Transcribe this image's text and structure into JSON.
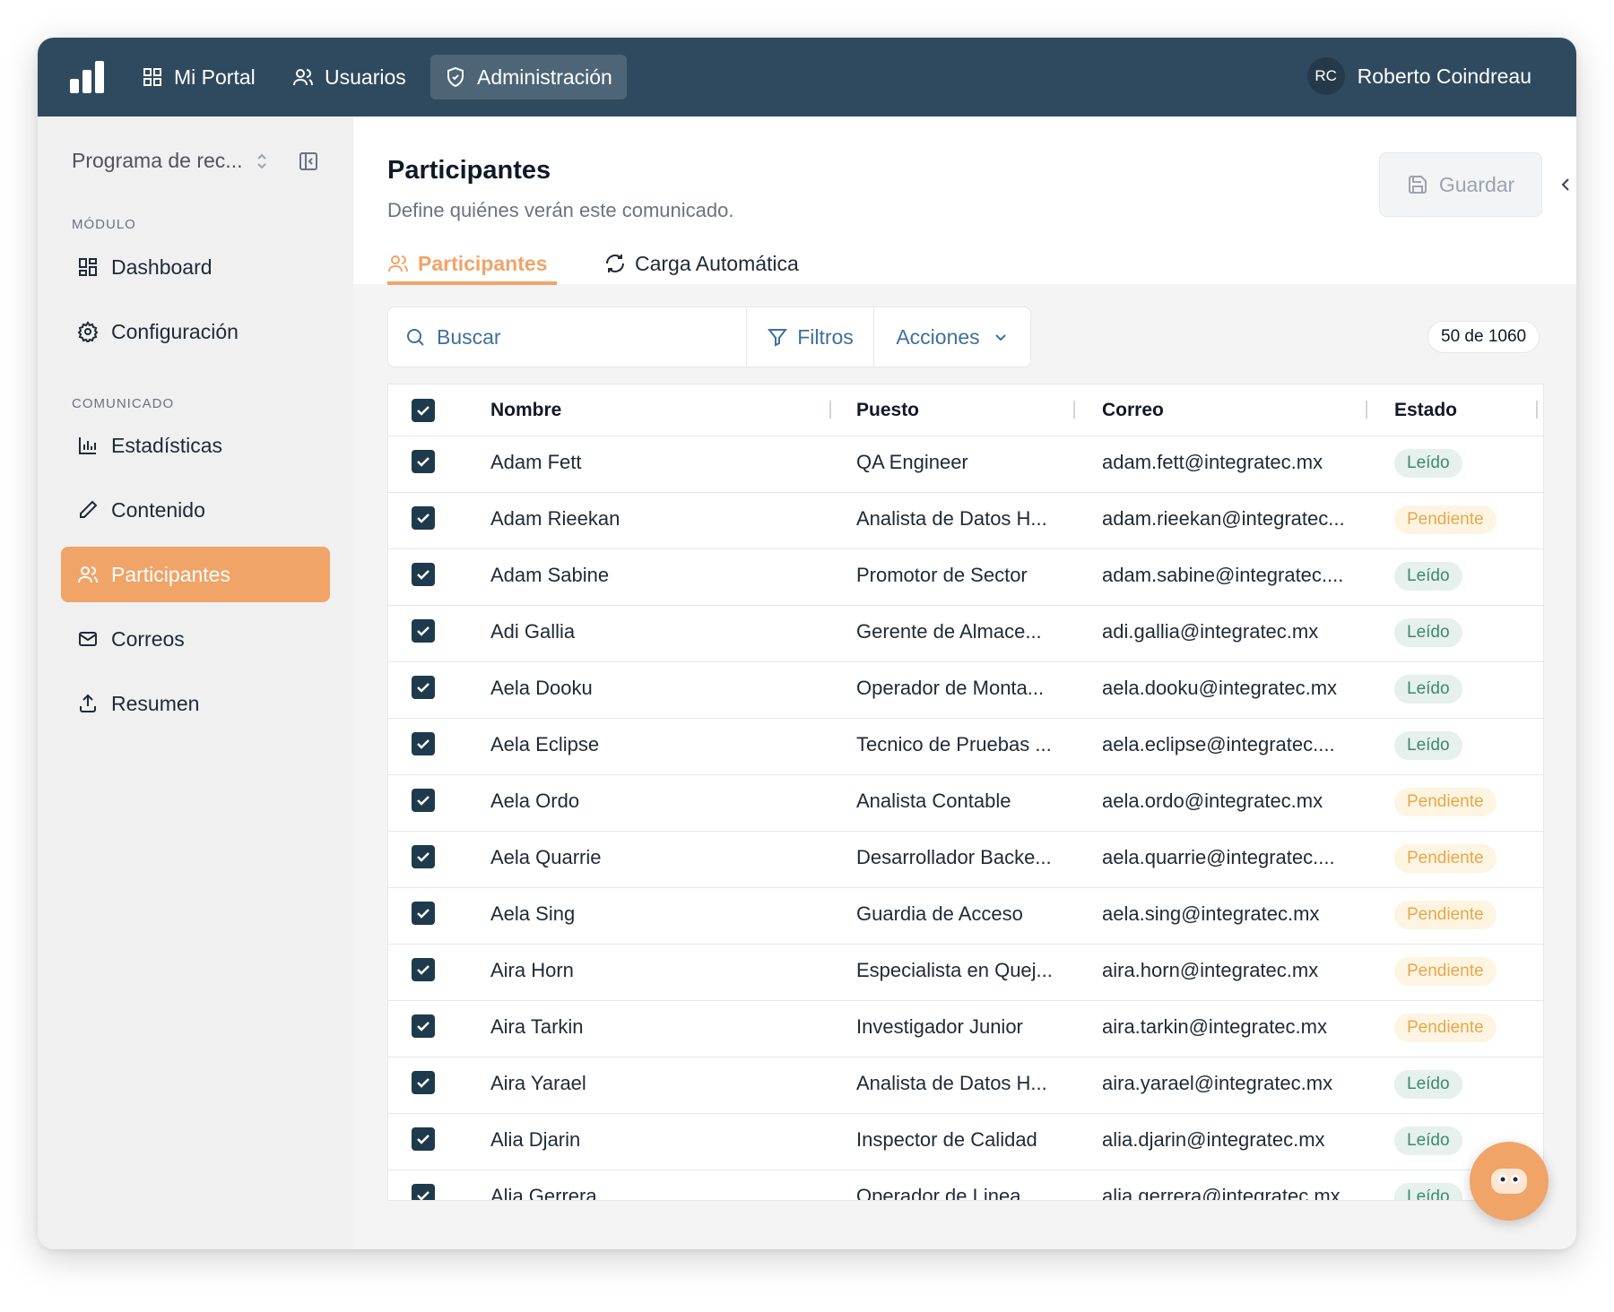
{
  "nav": {
    "items": [
      {
        "label": "Mi Portal",
        "icon": "grid-icon"
      },
      {
        "label": "Usuarios",
        "icon": "users-icon"
      },
      {
        "label": "Administración",
        "icon": "shield-icon"
      }
    ],
    "user": {
      "initials": "RC",
      "name": "Roberto Coindreau"
    }
  },
  "sidebar": {
    "program": "Programa de rec...",
    "section_module": "MÓDULO",
    "section_comunicado": "COMUNICADO",
    "items": [
      {
        "label": "Dashboard",
        "icon": "dashboard-icon"
      },
      {
        "label": "Configuración",
        "icon": "gear-icon"
      },
      {
        "label": "Estadísticas",
        "icon": "bar-chart-icon"
      },
      {
        "label": "Contenido",
        "icon": "pencil-icon"
      },
      {
        "label": "Participantes",
        "icon": "users-icon"
      },
      {
        "label": "Correos",
        "icon": "mail-icon"
      },
      {
        "label": "Resumen",
        "icon": "upload-icon"
      }
    ]
  },
  "main": {
    "title": "Participantes",
    "subtitle": "Define quiénes verán este comunicado.",
    "save_label": "Guardar",
    "tabs": [
      {
        "label": "Participantes",
        "icon": "users-icon"
      },
      {
        "label": "Carga Automática",
        "icon": "refresh-icon"
      }
    ],
    "search_placeholder": "Buscar",
    "filters_label": "Filtros",
    "actions_label": "Acciones",
    "count": "50 de 1060"
  },
  "table": {
    "headers": [
      "Nombre",
      "Puesto",
      "Correo",
      "Estado"
    ],
    "rows": [
      {
        "name": "Adam Fett",
        "role": "QA Engineer",
        "email": "adam.fett@integratec.mx",
        "status": "Leído"
      },
      {
        "name": "Adam Rieekan",
        "role": "Analista de Datos H...",
        "email": "adam.rieekan@integratec...",
        "status": "Pendiente"
      },
      {
        "name": "Adam Sabine",
        "role": "Promotor de Sector",
        "email": "adam.sabine@integratec....",
        "status": "Leído"
      },
      {
        "name": "Adi Gallia",
        "role": "Gerente de Almace...",
        "email": "adi.gallia@integratec.mx",
        "status": "Leído"
      },
      {
        "name": "Aela Dooku",
        "role": "Operador de Monta...",
        "email": "aela.dooku@integratec.mx",
        "status": "Leído"
      },
      {
        "name": "Aela Eclipse",
        "role": "Tecnico de Pruebas ...",
        "email": "aela.eclipse@integratec....",
        "status": "Leído"
      },
      {
        "name": "Aela Ordo",
        "role": "Analista Contable",
        "email": "aela.ordo@integratec.mx",
        "status": "Pendiente"
      },
      {
        "name": "Aela Quarrie",
        "role": "Desarrollador Backe...",
        "email": "aela.quarrie@integratec....",
        "status": "Pendiente"
      },
      {
        "name": "Aela Sing",
        "role": "Guardia de Acceso",
        "email": "aela.sing@integratec.mx",
        "status": "Pendiente"
      },
      {
        "name": "Aira Horn",
        "role": "Especialista en Quej...",
        "email": "aira.horn@integratec.mx",
        "status": "Pendiente"
      },
      {
        "name": "Aira Tarkin",
        "role": "Investigador Junior",
        "email": "aira.tarkin@integratec.mx",
        "status": "Pendiente"
      },
      {
        "name": "Aira Yarael",
        "role": "Analista de Datos H...",
        "email": "aira.yarael@integratec.mx",
        "status": "Leído"
      },
      {
        "name": "Alia Djarin",
        "role": "Inspector de Calidad",
        "email": "alia.djarin@integratec.mx",
        "status": "Leído"
      },
      {
        "name": "Alia Gerrera",
        "role": "Operador de Linea",
        "email": "alia.gerrera@integratec.mx",
        "status": "Leído"
      }
    ]
  },
  "colors": {
    "nav_bg": "#2f4a5e",
    "accent": "#f0a468",
    "link": "#3f6f9e"
  }
}
